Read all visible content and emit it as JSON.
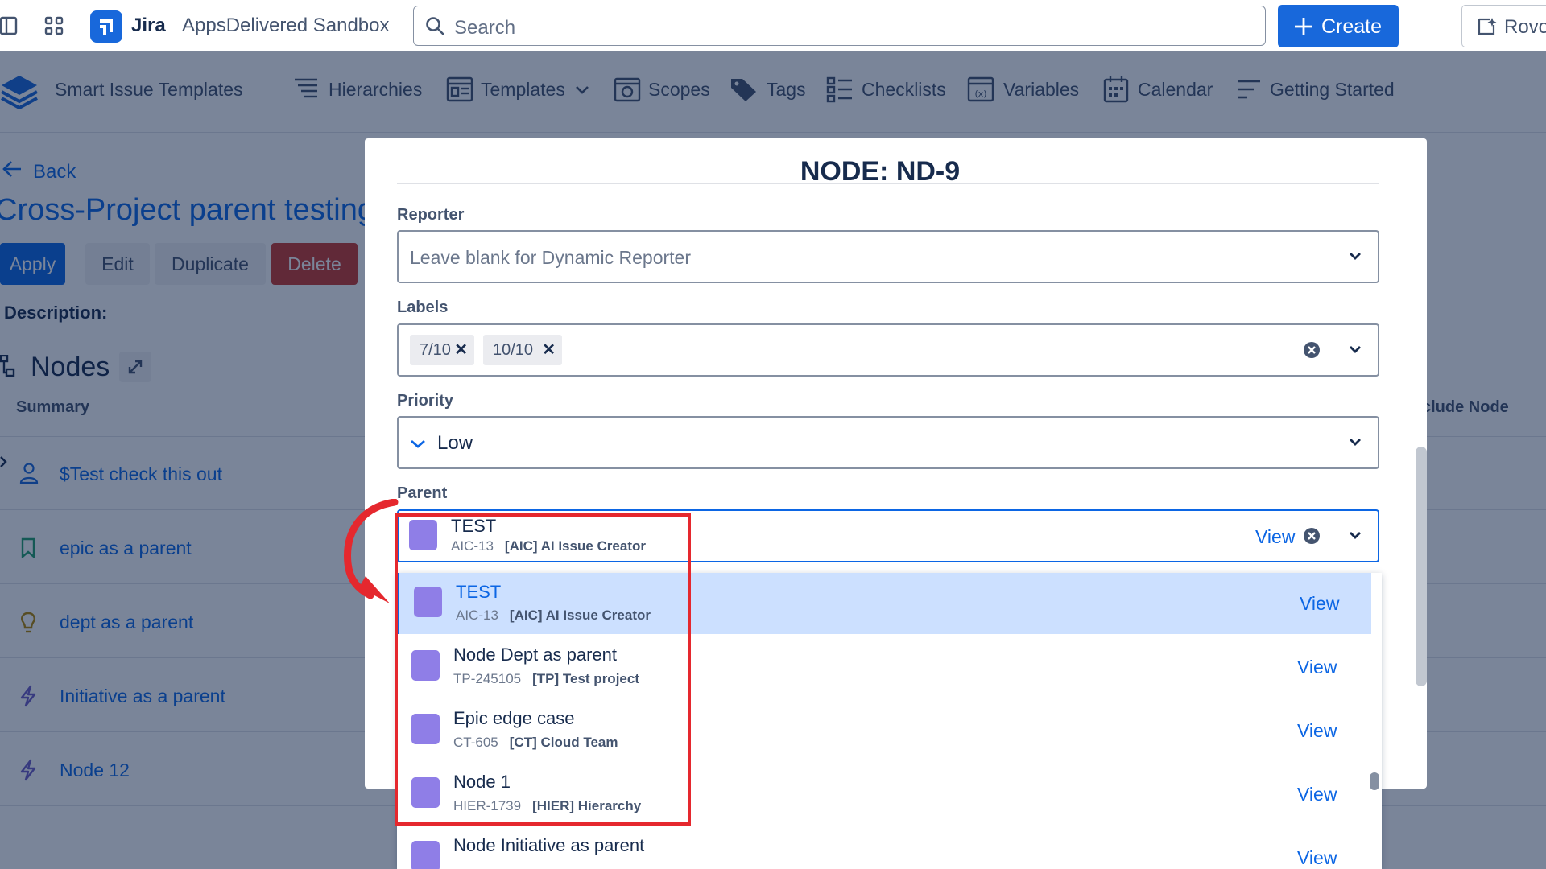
{
  "topnav": {
    "product": "Jira",
    "site": "AppsDelivered Sandbox",
    "search_placeholder": "Search",
    "create_label": "Create",
    "rovo_label": "Rovo"
  },
  "appbar": {
    "app_name": "Smart Issue Templates",
    "items": [
      "Hierarchies",
      "Templates",
      "Scopes",
      "Tags",
      "Checklists",
      "Variables",
      "Calendar",
      "Getting Started"
    ]
  },
  "page": {
    "back_label": "Back",
    "title": "Cross-Project parent testing",
    "buttons": {
      "apply": "Apply",
      "edit": "Edit",
      "duplicate": "Duplicate",
      "delete": "Delete"
    },
    "description_label": "Description:",
    "nodes_title": "Nodes",
    "columns": {
      "summary": "Summary",
      "include": "clude Node"
    },
    "rows": [
      "$Test check this out",
      "epic as a parent",
      "dept as a parent",
      "Initiative as a parent",
      "Node 12"
    ]
  },
  "modal": {
    "title": "NODE: ND-9",
    "reporter": {
      "label": "Reporter",
      "placeholder": "Leave blank for Dynamic Reporter"
    },
    "labels": {
      "label": "Labels",
      "tags": [
        "7/10",
        "10/10"
      ]
    },
    "priority": {
      "label": "Priority",
      "value": "Low"
    },
    "parent": {
      "label": "Parent",
      "selected": {
        "title": "TEST",
        "key": "AIC-13",
        "project": "[AIC] AI Issue Creator"
      },
      "view_label": "View"
    }
  },
  "dropdown": {
    "options": [
      {
        "title": "TEST",
        "key": "AIC-13",
        "project": "[AIC] AI Issue Creator",
        "view": "View"
      },
      {
        "title": "Node Dept as parent",
        "key": "TP-245105",
        "project": "[TP] Test project",
        "view": "View"
      },
      {
        "title": "Epic edge case",
        "key": "CT-605",
        "project": "[CT] Cloud Team",
        "view": "View"
      },
      {
        "title": "Node 1",
        "key": "HIER-1739",
        "project": "[HIER] Hierarchy",
        "view": "View"
      },
      {
        "title": "Node Initiative as parent",
        "view": "View"
      }
    ]
  },
  "colors": {
    "accent": "#0c66e4",
    "issue_purple": "#8f7ee7",
    "annotation_red": "#e5282e",
    "delete_red": "#c9372c"
  }
}
